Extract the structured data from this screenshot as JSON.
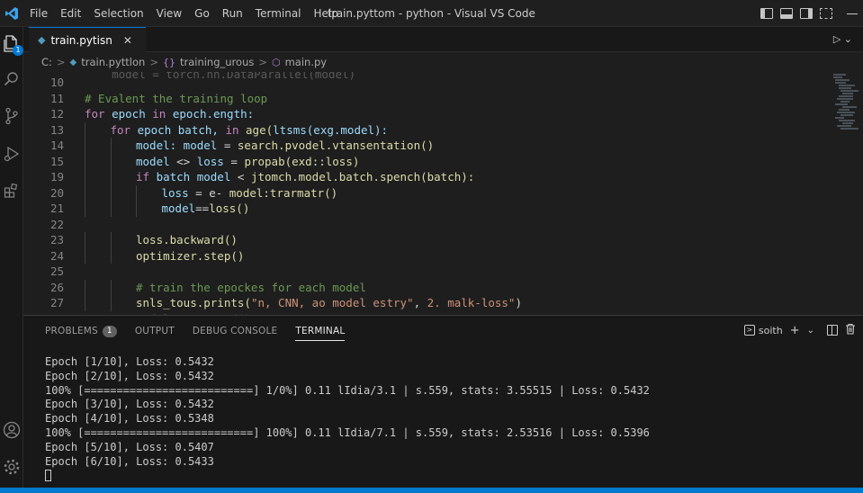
{
  "window": {
    "title": "train.pyttom - python - Visual VS Code"
  },
  "menu": [
    "File",
    "Edit",
    "Selection",
    "View",
    "Go",
    "Run",
    "Terminal",
    "Help"
  ],
  "activity": {
    "explorer_badge": "1"
  },
  "tab": {
    "label": "train.pytisn",
    "close": "✕"
  },
  "breadcrumb": {
    "drive": "C:",
    "items": [
      "train.pyttlon",
      "training_urous",
      "main.py"
    ],
    "sep": ">"
  },
  "editor": {
    "lines": [
      {
        "num": "10",
        "indent": 0,
        "segments": []
      },
      {
        "num": "11",
        "indent": 0,
        "segments": [
          {
            "c": "cm",
            "t": "# Evalent the training loop"
          }
        ]
      },
      {
        "num": "12",
        "indent": 0,
        "segments": [
          {
            "c": "kw",
            "t": "for "
          },
          {
            "c": "id",
            "t": "epoch "
          },
          {
            "c": "kw",
            "t": "in "
          },
          {
            "c": "id",
            "t": "epoch.ength:"
          }
        ]
      },
      {
        "num": "13",
        "indent": 1,
        "segments": [
          {
            "c": "kw",
            "t": "for "
          },
          {
            "c": "id",
            "t": "epoch batch, "
          },
          {
            "c": "kw",
            "t": "in "
          },
          {
            "c": "fn",
            "t": "age("
          },
          {
            "c": "id",
            "t": "ltsms(exg.model):"
          }
        ]
      },
      {
        "num": "14",
        "indent": 2,
        "segments": [
          {
            "c": "id",
            "t": "model: model "
          },
          {
            "c": "op",
            "t": "= "
          },
          {
            "c": "fn",
            "t": "search.pvodel.vtansentation()"
          }
        ]
      },
      {
        "num": "15",
        "indent": 2,
        "segments": [
          {
            "c": "id",
            "t": "model "
          },
          {
            "c": "op",
            "t": "<> "
          },
          {
            "c": "id",
            "t": "loss "
          },
          {
            "c": "op",
            "t": "= "
          },
          {
            "c": "fn",
            "t": "propab(exd::loss)"
          }
        ]
      },
      {
        "num": "19",
        "indent": 2,
        "segments": [
          {
            "c": "kw",
            "t": "if "
          },
          {
            "c": "id",
            "t": "batch model "
          },
          {
            "c": "op",
            "t": "< "
          },
          {
            "c": "fn",
            "t": "jtomch.model.batch.spench(batch):"
          }
        ]
      },
      {
        "num": "20",
        "indent": 3,
        "segments": [
          {
            "c": "id",
            "t": "loss "
          },
          {
            "c": "op",
            "t": "= e- "
          },
          {
            "c": "fn",
            "t": "model:trarmatr()"
          }
        ]
      },
      {
        "num": "21",
        "indent": 3,
        "segments": [
          {
            "c": "id",
            "t": "model"
          },
          {
            "c": "op",
            "t": "=="
          },
          {
            "c": "fn",
            "t": "loss()"
          }
        ]
      },
      {
        "num": "22",
        "indent": 0,
        "segments": []
      },
      {
        "num": "23",
        "indent": 2,
        "segments": [
          {
            "c": "fn",
            "t": "loss.backward()"
          }
        ]
      },
      {
        "num": "24",
        "indent": 2,
        "segments": [
          {
            "c": "fn",
            "t": "optimizer.step()"
          }
        ]
      },
      {
        "num": "25",
        "indent": 0,
        "segments": []
      },
      {
        "num": "26",
        "indent": 2,
        "segments": [
          {
            "c": "cm",
            "t": "# train the epockes for each model"
          }
        ]
      },
      {
        "num": "27",
        "indent": 2,
        "segments": [
          {
            "c": "fn",
            "t": "snls_tous.prints("
          },
          {
            "c": "st",
            "t": "\"n, CNN, ao model estry\""
          },
          {
            "c": "op",
            "t": ", "
          },
          {
            "c": "st",
            "t": "2. malk-loss\""
          },
          {
            "c": "op",
            "t": ")"
          }
        ]
      }
    ]
  },
  "panel": {
    "tabs": [
      "PROBLEMS",
      "OUTPUT",
      "DEBUG CONSOLE",
      "TERMINAL"
    ],
    "problems_count": "1",
    "terminal_name": "soith",
    "terminal_lines": [
      "Epoch [1/10], Loss: 0.5432",
      "Epoch [2/10], Loss: 0.5432",
      "100% [==========================] 1/0%] 0.11 lIdia/3.1 | s.559, stats: 3.55515 | Loss: 0.5432",
      "Epoch [3/10], Loss: 0.5432",
      "Epoch [4/10], Loss: 0.5348",
      "100% [==========================] 100%] 0.11 lIdia/7.1 | s.559, stats: 2.53516 | Loss: 0.5396",
      "Epoch [5/10], Loss: 0.5407",
      "Epoch [6/10], Loss: 0.5433"
    ]
  },
  "colors": {
    "accent": "#0078d4",
    "statusbar": "#007acc",
    "keyword": "#c586c0",
    "identifier": "#9cdcfe",
    "function": "#dcdcaa",
    "comment": "#6a9955",
    "string": "#ce9178"
  }
}
